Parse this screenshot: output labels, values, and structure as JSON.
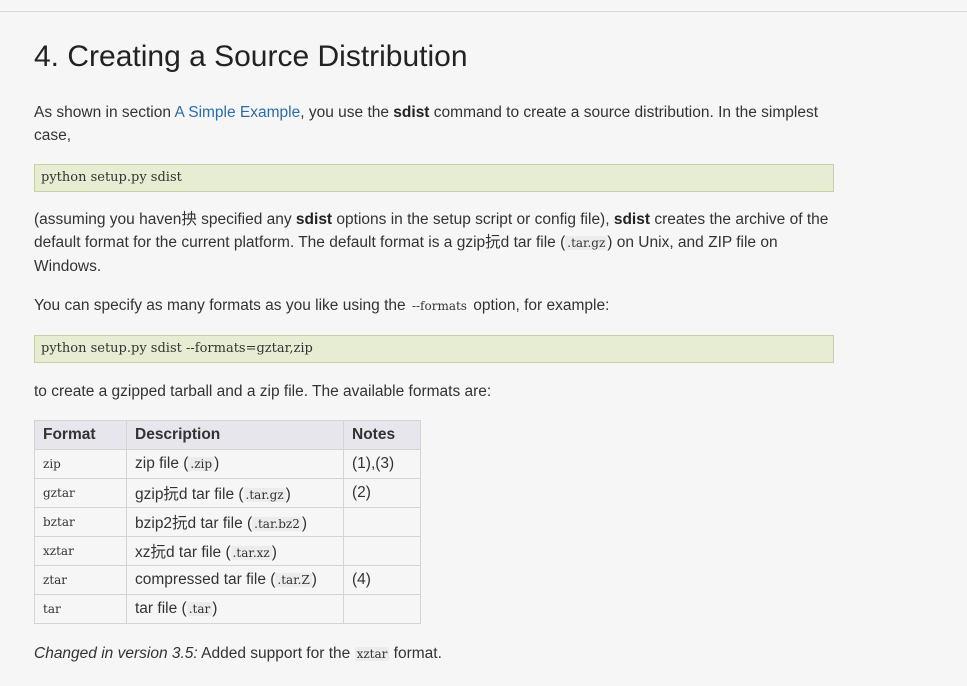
{
  "heading": "4. Creating a Source Distribution",
  "intro": {
    "p1": "As shown in section ",
    "link": "A Simple Example",
    "p2": ", you use the ",
    "cmd": "sdist",
    "p3": " command to create a source distribution. In the simplest case,"
  },
  "code1": "python setup.py sdist",
  "para2": {
    "a": "(assuming you haven抰 specified any ",
    "b": "sdist",
    "c": " options in the setup script or config file), ",
    "d": "sdist",
    "e": " creates the archive of the default format for the current platform. The default format is a gzip抏d tar file (",
    "f": ".tar.gz",
    "g": ") on Unix, and ZIP file on Windows."
  },
  "para3": {
    "a": "You can specify as many formats as you like using the ",
    "b": "--formats",
    "c": " option, for example:"
  },
  "code2": "python setup.py sdist --formats=gztar,zip",
  "para4": "to create a gzipped tarball and a zip file. The available formats are:",
  "table": {
    "headers": [
      "Format",
      "Description",
      "Notes"
    ],
    "rows": [
      {
        "format": "zip",
        "desc": "zip file (",
        "ext": ".zip",
        "notes": "(1),(3)"
      },
      {
        "format": "gztar",
        "desc": "gzip抏d tar file (",
        "ext": ".tar.gz",
        "notes": "(2)"
      },
      {
        "format": "bztar",
        "desc": "bzip2抏d tar file (",
        "ext": ".tar.bz2",
        "notes": ""
      },
      {
        "format": "xztar",
        "desc": "xz抏d tar file (",
        "ext": ".tar.xz",
        "notes": ""
      },
      {
        "format": "ztar",
        "desc": "compressed tar file (",
        "ext": ".tar.Z",
        "notes": "(4)"
      },
      {
        "format": "tar",
        "desc": "tar file (",
        "ext": ".tar",
        "notes": ""
      }
    ],
    "close_paren": ")"
  },
  "changed": {
    "label": "Changed in version 3.5:",
    "text": " Added support for the ",
    "code": "xztar",
    "end": " format."
  },
  "colors": {
    "background": "#f6f6f6",
    "code_block_bg": "#e7edd2",
    "link": "#2b6ca8",
    "table_header_bg": "#e6e6ec"
  }
}
